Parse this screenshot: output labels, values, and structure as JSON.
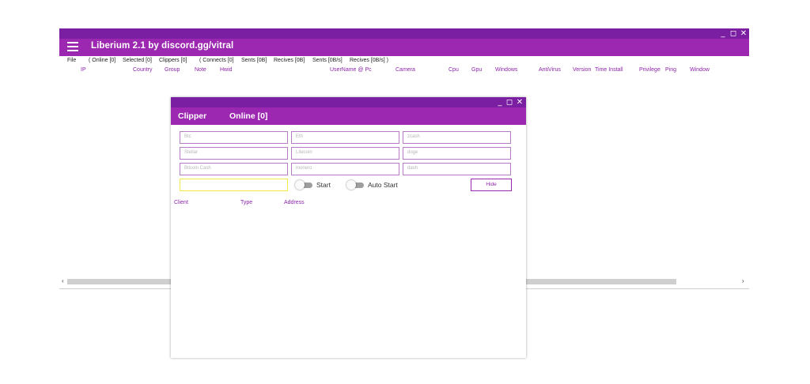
{
  "main_window": {
    "title": "Liberium 2.1 by discord.gg/vitral",
    "controls": {
      "minimize": "_",
      "maximize": "◻",
      "close": "✕"
    },
    "menu": [
      "File",
      "( Online [0]",
      "Selected [0]",
      "Clippers [0]",
      "( Connects [0]",
      "Sents [0B]",
      "Recives [0B]",
      "Sents [0B/s]",
      "Recives [0B/s] )"
    ],
    "columns": [
      "IP",
      "Country",
      "Group",
      "Note",
      "Hwid",
      "UserName @ Pc",
      "Camera",
      "Cpu",
      "Gpu",
      "Windows",
      "AntiVirus",
      "Version",
      "Time Install",
      "Privilege",
      "Ping",
      "Window"
    ],
    "scroll_left": "‹",
    "scroll_right": "›"
  },
  "clipper": {
    "title": "Clipper",
    "online": "Online [0]",
    "controls": {
      "minimize": "_",
      "maximize": "◻",
      "close": "✕"
    },
    "fields": [
      "Btc",
      "Eth",
      "zcash",
      "Stellar",
      "Litecoin",
      "doge",
      "Bitcoin Cash",
      "monero",
      "dash"
    ],
    "client_value": "",
    "start_label": "Start",
    "auto_start_label": "Auto Start",
    "hide_label": "Hide",
    "columns": [
      "Client",
      "Type",
      "Address"
    ]
  },
  "colors": {
    "titlebar": "#7b1fa2",
    "header": "#9c27b0",
    "accent_text": "#8e24aa"
  }
}
